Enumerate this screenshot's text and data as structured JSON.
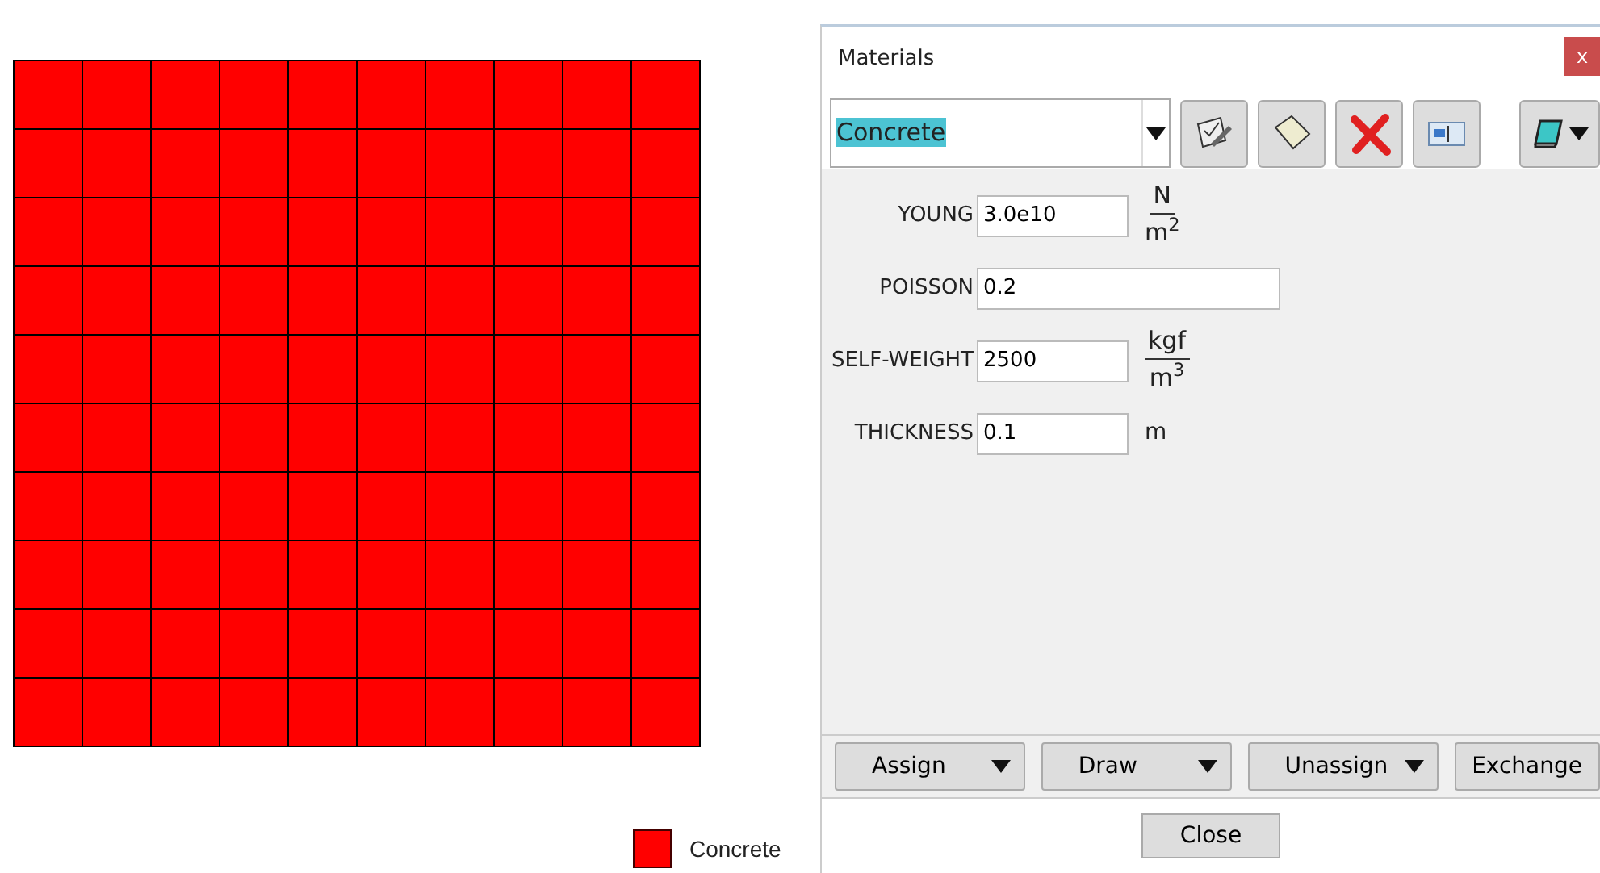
{
  "mesh": {
    "color": "#ff0000"
  },
  "legend": [
    {
      "label": "Concrete",
      "color": "#ff0000"
    }
  ],
  "dialog": {
    "title": "Materials",
    "close": "x",
    "material": {
      "value": "Concrete",
      "text_selected": true
    },
    "toolbar": [
      {
        "kind": "edit"
      },
      {
        "kind": "new"
      },
      {
        "kind": "delete"
      },
      {
        "kind": "rename"
      }
    ],
    "properties": [
      {
        "label": "YOUNG",
        "value": "3.0e10",
        "wide": false,
        "unit": {
          "kind": "fraction",
          "numerator": "N",
          "denominator": "m$^{2}$"
        }
      },
      {
        "label": "POISSON",
        "value": "0.2",
        "wide": true
      },
      {
        "label": "SELF-WEIGHT",
        "value": "2500",
        "wide": false,
        "unit": {
          "kind": "fraction",
          "numerator": "kgf",
          "denominator": "m$^{3}$"
        }
      },
      {
        "label": "THICKNESS",
        "value": "0.1",
        "wide": false,
        "unit": {
          "kind": "plain",
          "text": "m"
        }
      }
    ],
    "actions": [
      {
        "label": "Assign",
        "menu": true
      },
      {
        "label": "Draw",
        "menu": true
      },
      {
        "label": "Unassign",
        "menu": true
      },
      {
        "label": "Exchange",
        "menu": false
      }
    ],
    "footer_button": "Close"
  }
}
